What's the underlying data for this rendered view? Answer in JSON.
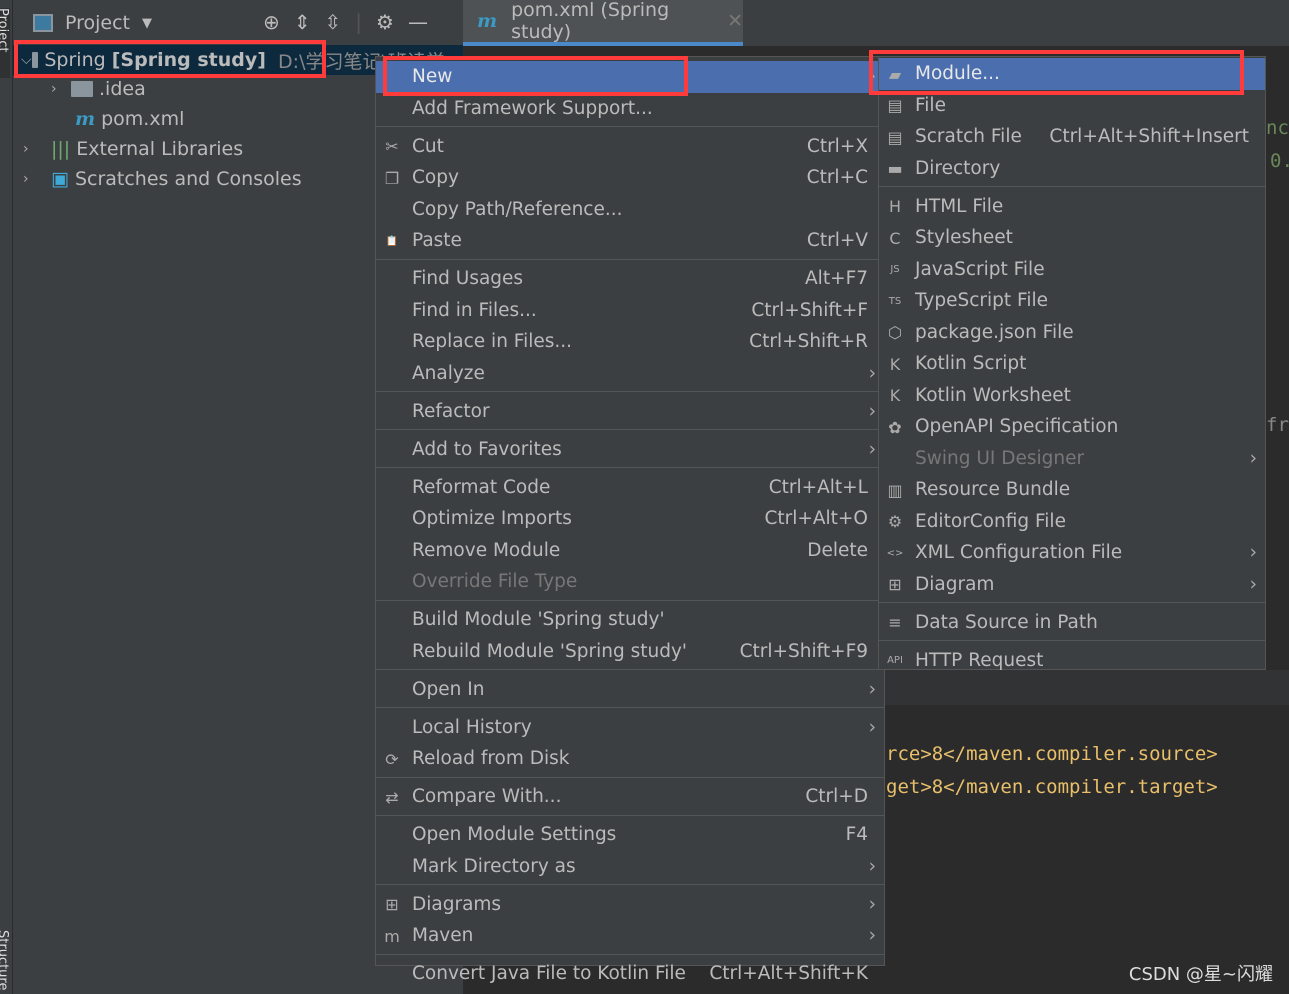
{
  "sidebar_strip": {
    "top": "Project",
    "bottom": "Structure"
  },
  "project_panel": {
    "title": "Project",
    "tree": [
      {
        "label": "Spring",
        "bold": "[Spring study]",
        "path": "D:\\学习笔记\\班读学..."
      },
      {
        "label": ".idea"
      },
      {
        "label": "pom.xml"
      },
      {
        "label": "External Libraries"
      },
      {
        "label": "Scratches and Consoles"
      }
    ]
  },
  "editor": {
    "tab": "pom.xml (Spring study)",
    "lines": [
      "rce>8</maven.compiler.source>",
      "get>8</maven.compiler.target>"
    ],
    "peek": [
      "nce",
      "0.",
      "fra"
    ]
  },
  "context_menu": [
    {
      "label": "New",
      "hl": true,
      "arrow": true
    },
    {
      "label": "Add Framework Support..."
    },
    {
      "sep": true
    },
    {
      "label": "Cut",
      "sc": "Ctrl+X",
      "icon": "✂",
      "iname": "scissors-icon"
    },
    {
      "label": "Copy",
      "sc": "Ctrl+C",
      "icon": "❐",
      "iname": "copy-icon"
    },
    {
      "label": "Copy Path/Reference..."
    },
    {
      "label": "Paste",
      "sc": "Ctrl+V",
      "icon": "📋",
      "iname": "clipboard-icon"
    },
    {
      "sep": true
    },
    {
      "label": "Find Usages",
      "sc": "Alt+F7"
    },
    {
      "label": "Find in Files...",
      "sc": "Ctrl+Shift+F"
    },
    {
      "label": "Replace in Files...",
      "sc": "Ctrl+Shift+R"
    },
    {
      "label": "Analyze",
      "arrow": true
    },
    {
      "sep": true
    },
    {
      "label": "Refactor",
      "arrow": true
    },
    {
      "sep": true
    },
    {
      "label": "Add to Favorites",
      "arrow": true
    },
    {
      "sep": true
    },
    {
      "label": "Reformat Code",
      "sc": "Ctrl+Alt+L"
    },
    {
      "label": "Optimize Imports",
      "sc": "Ctrl+Alt+O"
    },
    {
      "label": "Remove Module",
      "sc": "Delete"
    },
    {
      "label": "Override File Type",
      "dis": true
    },
    {
      "sep": true
    },
    {
      "label": "Build Module 'Spring study'"
    },
    {
      "label": "Rebuild Module 'Spring study'",
      "sc": "Ctrl+Shift+F9"
    },
    {
      "sep": true
    },
    {
      "label": "Open In",
      "arrow": true
    },
    {
      "sep": true
    },
    {
      "label": "Local History",
      "arrow": true
    },
    {
      "label": "Reload from Disk",
      "icon": "⟳",
      "iname": "reload-icon"
    },
    {
      "sep": true
    },
    {
      "label": "Compare With...",
      "sc": "Ctrl+D",
      "icon": "⇄",
      "iname": "compare-icon"
    },
    {
      "sep": true
    },
    {
      "label": "Open Module Settings",
      "sc": "F4"
    },
    {
      "label": "Mark Directory as",
      "arrow": true
    },
    {
      "sep": true
    },
    {
      "label": "Diagrams",
      "arrow": true,
      "icon": "⊞",
      "iname": "diagram-icon"
    },
    {
      "label": "Maven",
      "arrow": true,
      "icon": "m",
      "iname": "maven-icon"
    },
    {
      "sep": true
    },
    {
      "label": "Convert Java File to Kotlin File",
      "sc": "Ctrl+Alt+Shift+K"
    }
  ],
  "new_submenu": [
    {
      "label": "Module...",
      "hl": true,
      "icon": "▰",
      "iname": "module-icon"
    },
    {
      "label": "File",
      "icon": "▤",
      "iname": "file-icon"
    },
    {
      "label": "Scratch File",
      "sc": "Ctrl+Alt+Shift+Insert",
      "icon": "▤",
      "iname": "scratch-file-icon"
    },
    {
      "label": "Directory",
      "icon": "▬",
      "iname": "folder-icon"
    },
    {
      "sep": true
    },
    {
      "label": "HTML File",
      "icon": "H",
      "iname": "html-file-icon"
    },
    {
      "label": "Stylesheet",
      "icon": "C",
      "iname": "css-file-icon"
    },
    {
      "label": "JavaScript File",
      "icon": "JS",
      "iname": "js-file-icon"
    },
    {
      "label": "TypeScript File",
      "icon": "TS",
      "iname": "ts-file-icon"
    },
    {
      "label": "package.json File",
      "icon": "⬡",
      "iname": "nodejs-icon"
    },
    {
      "label": "Kotlin Script",
      "icon": "K",
      "iname": "kotlin-icon"
    },
    {
      "label": "Kotlin Worksheet",
      "icon": "K",
      "iname": "kotlin-worksheet-icon"
    },
    {
      "label": "OpenAPI Specification",
      "icon": "✿",
      "iname": "openapi-icon"
    },
    {
      "label": "Swing UI Designer",
      "dis": true,
      "arrow": true
    },
    {
      "label": "Resource Bundle",
      "icon": "▥",
      "iname": "resource-bundle-icon"
    },
    {
      "label": "EditorConfig File",
      "icon": "⚙",
      "iname": "gear-icon"
    },
    {
      "label": "XML Configuration File",
      "arrow": true,
      "icon": "<>",
      "iname": "xml-file-icon"
    },
    {
      "label": "Diagram",
      "arrow": true,
      "icon": "⊞",
      "iname": "diagram-icon"
    },
    {
      "sep": true
    },
    {
      "label": "Data Source in Path",
      "icon": "≡",
      "iname": "database-icon"
    },
    {
      "sep": true
    },
    {
      "label": "HTTP Request",
      "icon": "API",
      "iname": "api-icon"
    }
  ],
  "watermark": "CSDN @星~闪耀"
}
